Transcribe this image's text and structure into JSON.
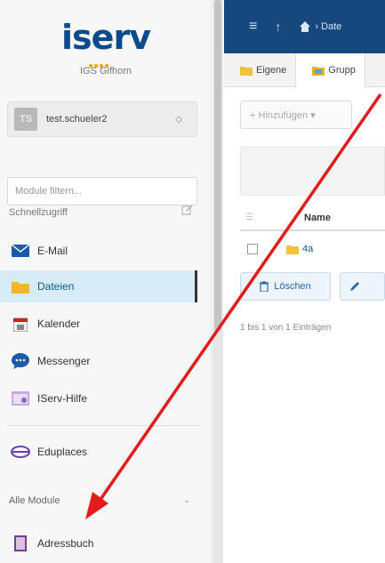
{
  "sidebar": {
    "logo": "iserv",
    "school": "IGS Gifhorn",
    "user": {
      "initials": "TS",
      "name": "test.schueler2",
      "caret": "◇"
    },
    "filter_placeholder": "Module filtern...",
    "quick_access_label": "Schnellzugriff",
    "items": [
      {
        "label": "E-Mail"
      },
      {
        "label": "Dateien"
      },
      {
        "label": "Kalender"
      },
      {
        "label": "Messenger"
      },
      {
        "label": "IServ-Hilfe"
      },
      {
        "label": "Eduplaces"
      }
    ],
    "all_modules_label": "Alle Module",
    "all_modules_caret": "⌄",
    "extra_items": [
      {
        "label": "Adressbuch"
      }
    ]
  },
  "main": {
    "topbar": {
      "menu": "≡",
      "up": "↑",
      "breadcrumb": "› Date"
    },
    "tabs": [
      {
        "label": "Eigene"
      },
      {
        "label": "Grupp"
      }
    ],
    "add_button": "+ Hinzufügen ▾",
    "table": {
      "select_icon": "☰",
      "column": "Name",
      "rows": [
        {
          "name": "4a"
        }
      ]
    },
    "delete_button": "Löschen",
    "count_text": "1 bis 1 von 1 Einträgen"
  },
  "colors": {
    "brand": "#0d4a8b",
    "topbar": "#16487d",
    "active_item": "#d7ecf6",
    "annotation_arrow": "#e41b1b"
  }
}
